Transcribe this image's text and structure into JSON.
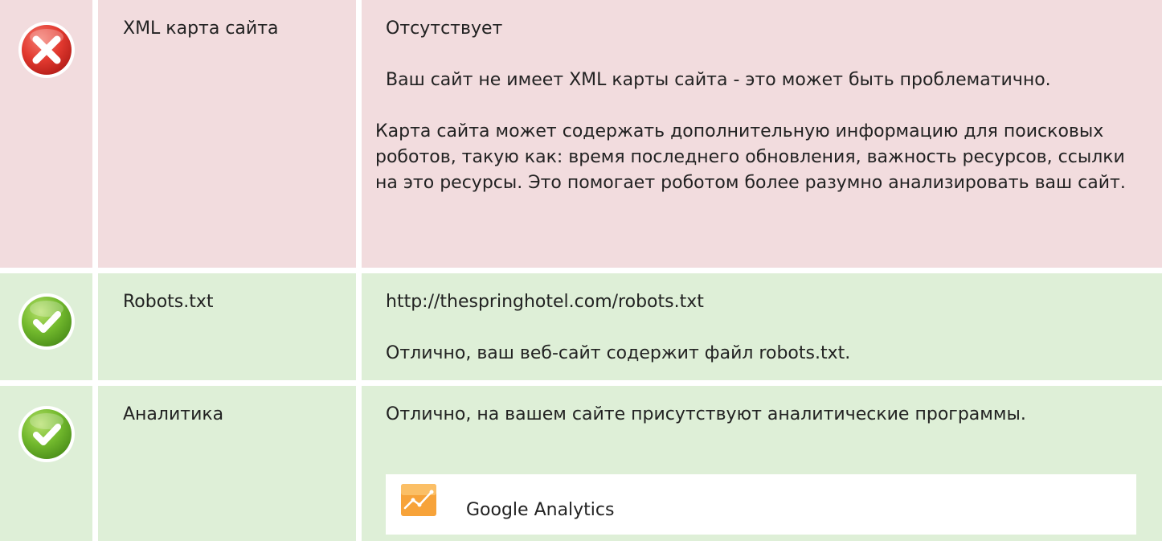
{
  "rows": [
    {
      "status": "error",
      "label": "XML карта сайта",
      "value": "Отсутствует",
      "message": "Ваш сайт не имеет XML карты сайта - это может быть проблематично.",
      "details": "Карта сайта может содержать дополнительную информацию для поисковых роботов, такую как: время последнего обновления, важность ресурсов, ссылки на это ресурсы. Это помогает роботом более разумно анализировать ваш сайт."
    },
    {
      "status": "ok",
      "label": "Robots.txt",
      "value": "http://thespringhotel.com/robots.txt",
      "message": "Отлично, ваш веб-сайт содержит файл robots.txt."
    },
    {
      "status": "ok",
      "label": "Аналитика",
      "message": "Отлично, на вашем сайте присутствуют аналитические программы.",
      "tools": [
        {
          "name": "Google Analytics",
          "icon": "google-analytics-icon"
        }
      ]
    }
  ],
  "colors": {
    "error_bg": "#f2dcde",
    "ok_bg": "#deefd7",
    "error_icon": "#d9332b",
    "ok_icon": "#6fb52c",
    "analytics_icon": "#f7a33a"
  }
}
